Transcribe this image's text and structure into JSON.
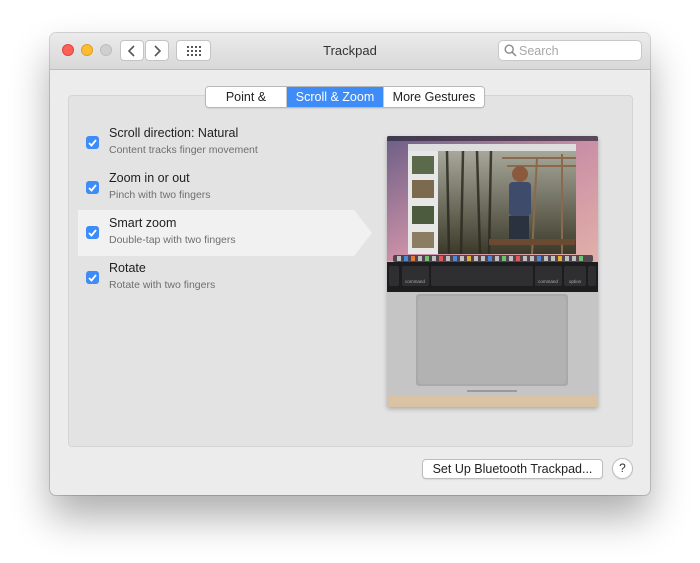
{
  "window": {
    "title": "Trackpad"
  },
  "search": {
    "placeholder": "Search",
    "value": ""
  },
  "tabs": [
    {
      "label": "Point & Click",
      "active": false
    },
    {
      "label": "Scroll & Zoom",
      "active": true
    },
    {
      "label": "More Gestures",
      "active": false
    }
  ],
  "options": [
    {
      "label": "Scroll direction: Natural",
      "description": "Content tracks finger movement",
      "checked": true
    },
    {
      "label": "Zoom in or out",
      "description": "Pinch with two fingers",
      "checked": true
    },
    {
      "label": "Smart zoom",
      "description": "Double-tap with two fingers",
      "checked": true,
      "selected": true
    },
    {
      "label": "Rotate",
      "description": "Rotate with two fingers",
      "checked": true
    }
  ],
  "touchbar": {
    "left_key": "command",
    "right_key": "command",
    "option_key": "option"
  },
  "footer": {
    "setup_button": "Set Up Bluetooth Trackpad...",
    "help_button": "?"
  },
  "colors": {
    "accent": "#3e8cf7",
    "close": "#fe5f57",
    "minimize": "#febc2e"
  },
  "icons": [
    "close-button",
    "minimize-button",
    "zoom-button",
    "chevron-left-icon",
    "chevron-right-icon",
    "grid-icon",
    "search-icon",
    "checkmark-icon"
  ]
}
